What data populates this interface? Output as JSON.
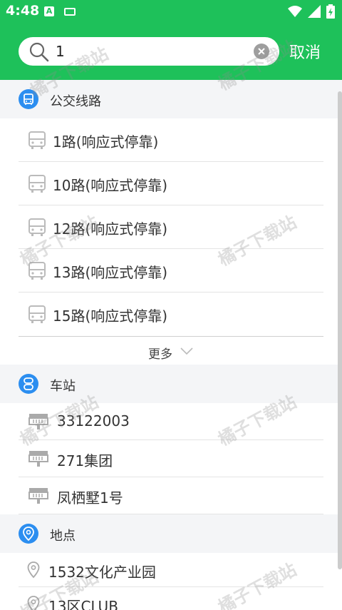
{
  "status_bar": {
    "time": "4:48",
    "notif_letter": "A"
  },
  "search": {
    "value": "1",
    "cancel_label": "取消"
  },
  "sections": {
    "bus_lines": {
      "title": "公交线路",
      "items": [
        "1路(响应式停靠)",
        "10路(响应式停靠)",
        "12路(响应式停靠)",
        "13路(响应式停靠)",
        "15路(响应式停靠)"
      ],
      "more_label": "更多"
    },
    "stations": {
      "title": "车站",
      "items": [
        "33122003",
        "271集团",
        "凤栖墅1号"
      ]
    },
    "places": {
      "title": "地点",
      "items": [
        "1532文化产业园",
        "13区CLUB"
      ]
    }
  },
  "watermark": "橘子下载站",
  "colors": {
    "brand": "#1ec15a",
    "section_icon": "#2c8ef0",
    "section_bg": "#f4f5f7"
  },
  "icons": {
    "bus_row": "bus-icon",
    "station_row": "station-sign-icon",
    "place_row": "location-pin-icon",
    "bus_section": "bus-icon",
    "station_section": "station-icon",
    "place_section": "location-icon"
  }
}
